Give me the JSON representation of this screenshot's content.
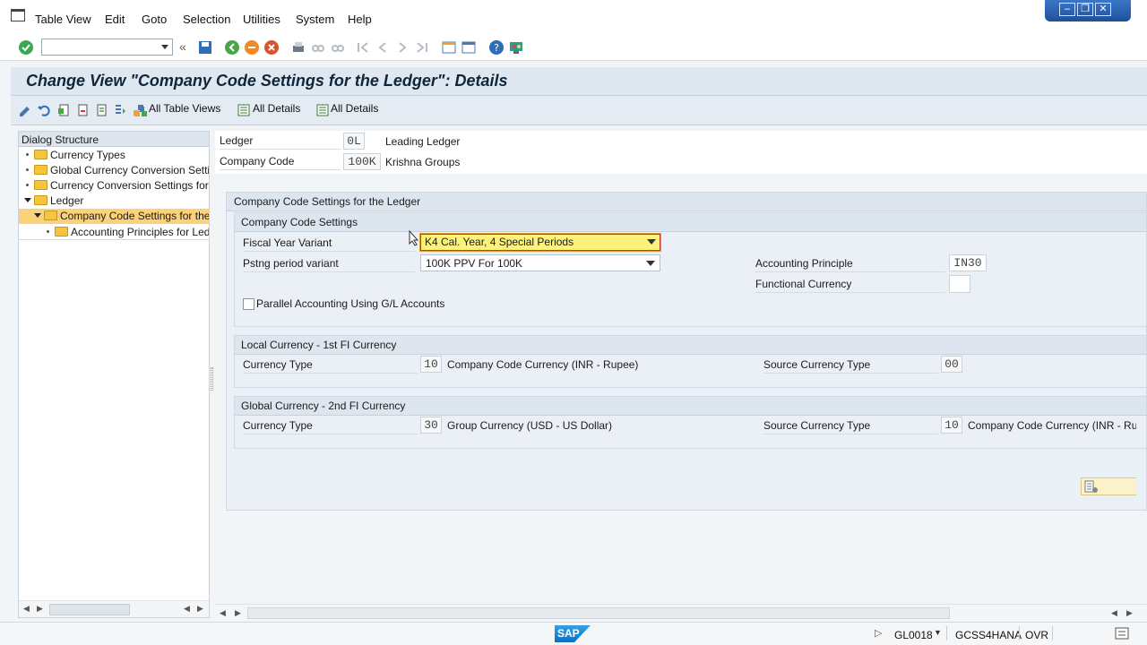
{
  "menu": [
    "Table View",
    "Edit",
    "Goto",
    "Selection",
    "Utilities",
    "System",
    "Help"
  ],
  "window_controls": [
    "minimize",
    "restore",
    "close"
  ],
  "title": "Change View \"Company Code Settings for the Ledger\": Details",
  "app_toolbar": {
    "all_table_views": "All Table Views",
    "all_details_1": "All Details",
    "all_details_2": "All Details"
  },
  "dialog": {
    "header": "Dialog Structure",
    "items": [
      {
        "label": "Currency Types"
      },
      {
        "label": "Global Currency Conversion Settin"
      },
      {
        "label": "Currency Conversion Settings for"
      },
      {
        "label": "Ledger"
      },
      {
        "label": "Company Code Settings for the"
      },
      {
        "label": "Accounting Principles for Ledg"
      }
    ]
  },
  "header_fields": {
    "ledger_label": "Ledger",
    "ledger_value": "0L",
    "ledger_text": "Leading Ledger",
    "company_code_label": "Company Code",
    "company_code_value": "100K",
    "company_code_text": "Krishna Groups"
  },
  "section": {
    "title": "Company Code Settings for the Ledger",
    "ccs": {
      "title": "Company Code Settings",
      "fiscal_year_variant_label": "Fiscal Year Variant",
      "fiscal_year_variant_value": "K4 Cal. Year, 4 Special Periods",
      "posting_period_variant_label": "Pstng period variant",
      "posting_period_variant_value": "100K PPV For 100K",
      "accounting_principle_label": "Accounting Principle",
      "accounting_principle_value": "IN30",
      "functional_currency_label": "Functional Currency",
      "functional_currency_value": "",
      "parallel_accounting_label": "Parallel Accounting Using G/L Accounts"
    },
    "local": {
      "title": "Local Currency - 1st FI Currency",
      "currency_type_label": "Currency Type",
      "currency_type_value": "10",
      "currency_type_text": "Company Code Currency (INR - Rupee)",
      "source_currency_type_label": "Source Currency Type",
      "source_currency_type_value": "00"
    },
    "global": {
      "title": "Global Currency - 2nd FI Currency",
      "currency_type_label": "Currency Type",
      "currency_type_value": "30",
      "currency_type_text": "Group Currency (USD - US Dollar)",
      "source_currency_type_label": "Source Currency Type",
      "source_currency_type_value": "10",
      "source_currency_type_text": "Company Code Currency (INR - Ru"
    }
  },
  "status": {
    "logo": "SAP",
    "transaction": "GL0018",
    "system": "GCSS4HANA",
    "mode": "OVR"
  }
}
